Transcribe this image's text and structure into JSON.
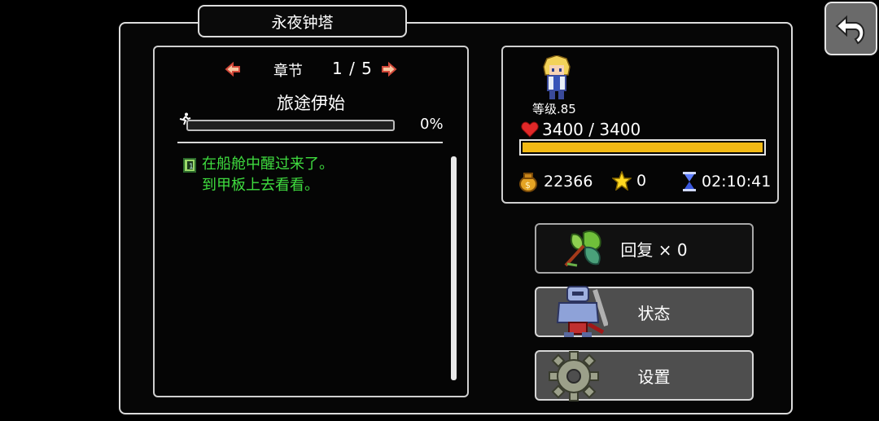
{
  "window": {
    "title": "永夜钟塔"
  },
  "chapter": {
    "label": "章节",
    "page": "1 / 5",
    "name": "旅途伊始",
    "progress_text": "0%",
    "progress_value": 0
  },
  "quest": {
    "lines": [
      "在船舱中醒过来了。",
      "到甲板上去看看。"
    ],
    "color": "#3fdc3f"
  },
  "hero": {
    "level": "等级.85",
    "hp": "3400 / 3400",
    "gold": "22366",
    "stars": "0",
    "time": "02:10:41",
    "hp_color": "#f2b914"
  },
  "buttons": {
    "recover": "回复 × 0",
    "status": "状态",
    "settings": "设置"
  },
  "icons": {
    "back": "back-arrow-icon",
    "prev": "prev-chapter-icon",
    "next": "next-chapter-icon",
    "runner": "runner-icon",
    "quest": "quest-book-icon",
    "heart": "heart-icon",
    "gold": "gold-bag-icon",
    "star": "star-icon",
    "hourglass": "hourglass-icon",
    "herb": "herb-leaves-icon",
    "armor": "armor-icon",
    "gear": "gear-icon"
  }
}
